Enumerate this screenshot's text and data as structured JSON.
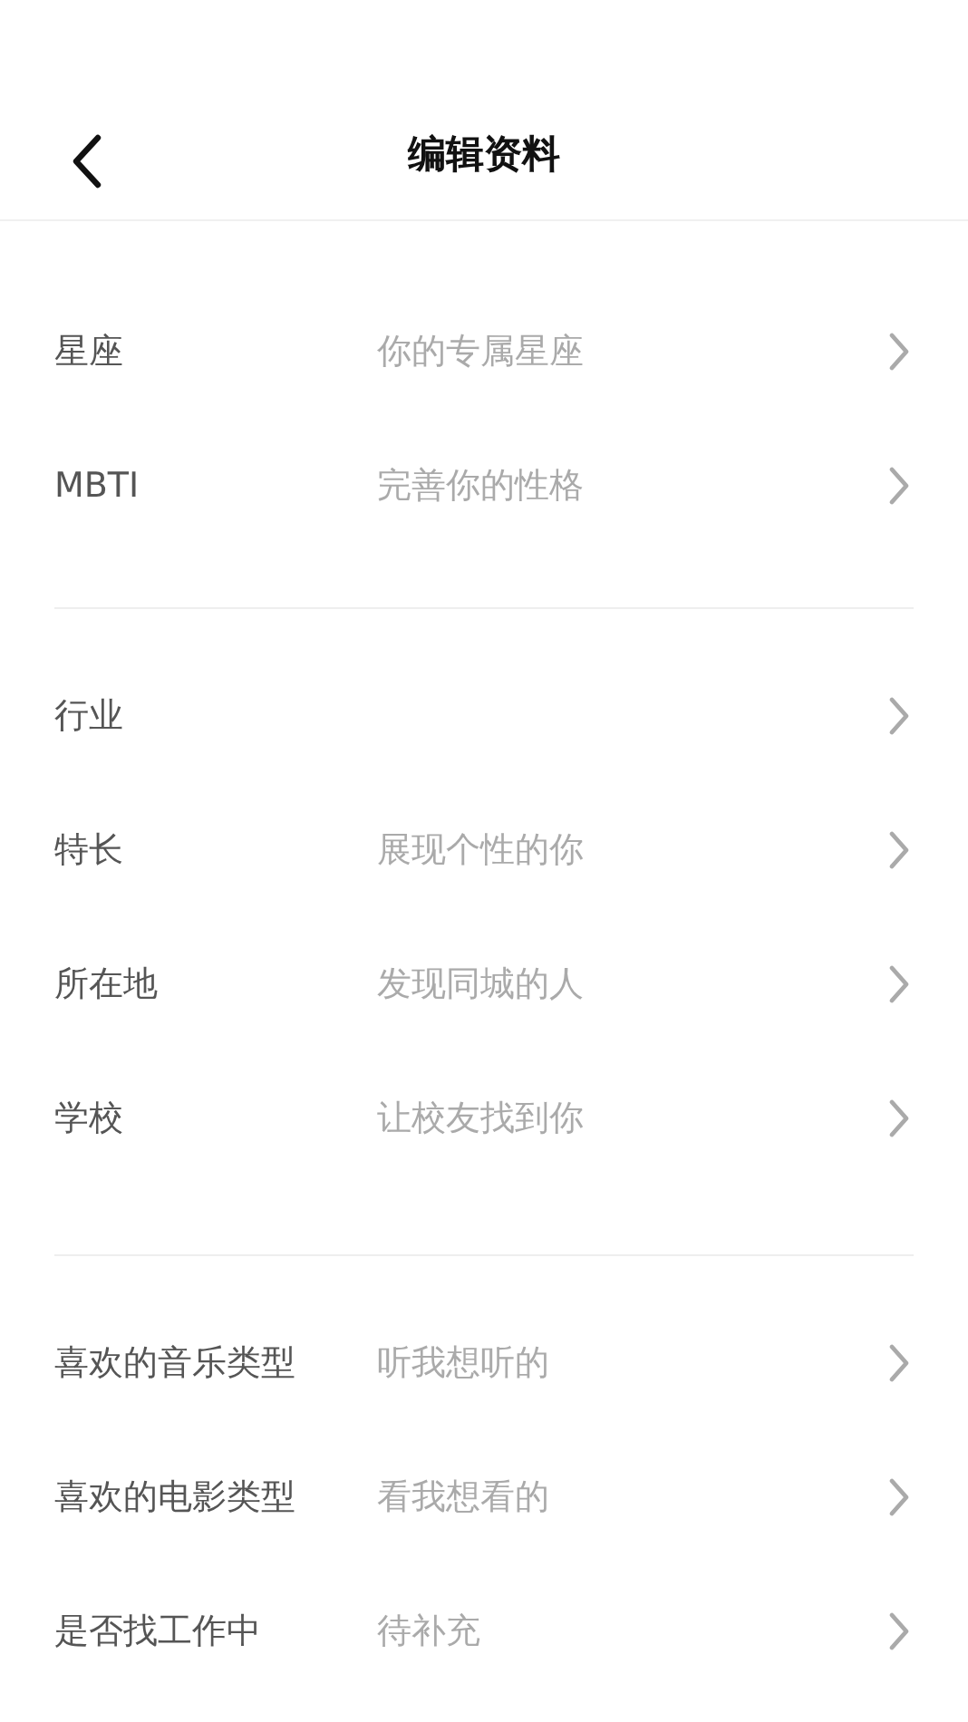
{
  "header": {
    "title": "编辑资料"
  },
  "sections": [
    {
      "rows": [
        {
          "label": "星座",
          "value": "你的专属星座"
        },
        {
          "label": "MBTI",
          "value": "完善你的性格"
        }
      ]
    },
    {
      "rows": [
        {
          "label": "行业"
        },
        {
          "label": "特长",
          "value": "展现个性的你"
        },
        {
          "label": "所在地",
          "value": "发现同城的人"
        },
        {
          "label": "学校",
          "value": "让校友找到你"
        }
      ]
    },
    {
      "rows": [
        {
          "label": "喜欢的音乐类型",
          "value": "听我想听的"
        },
        {
          "label": "喜欢的电影类型",
          "value": "看我想看的"
        },
        {
          "label": "是否找工作中",
          "value": "待补充"
        }
      ]
    }
  ]
}
